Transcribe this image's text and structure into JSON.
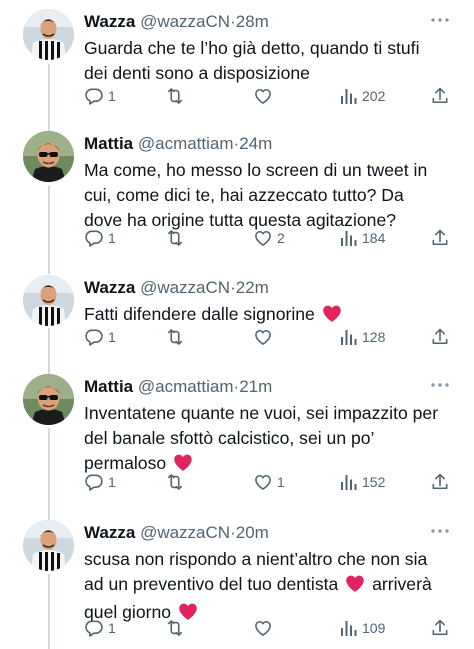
{
  "colors": {
    "muted": "#536471",
    "heart_emoji": "#e0245e",
    "thread_line": "#cfd9de"
  },
  "icons": {
    "reply": "speech-bubble",
    "retweet": "retweet-arrows",
    "like": "heart-outline",
    "views": "bar-chart",
    "share": "share-arrow-up",
    "more": "three-dots",
    "emoji": "red-heart"
  },
  "tweets": [
    {
      "name": "Wazza",
      "handle": "@wazzaCN",
      "dot": "·",
      "time": "28m",
      "lines": [
        "Guarda che te l’ho già detto, quando ti stufi",
        "dei denti sono a disposizione"
      ],
      "replies": "1",
      "retweets": "",
      "likes": "",
      "views": "202"
    },
    {
      "name": "Mattia",
      "handle": "@acmattiam",
      "dot": "·",
      "time": "24m",
      "lines": [
        "Ma come, ho messo lo screen di un tweet in",
        "cui, come dici te, hai azzeccato tutto? Da",
        "dove ha origine tutta questa agitazione?"
      ],
      "replies": "1",
      "retweets": "",
      "likes": "2",
      "views": "184"
    },
    {
      "name": "Wazza",
      "handle": "@wazzaCN",
      "dot": "·",
      "time": "22m",
      "text": "Fatti difendere dalle signorine",
      "replies": "1",
      "retweets": "",
      "likes": "",
      "views": "128"
    },
    {
      "name": "Mattia",
      "handle": "@acmattiam",
      "dot": "·",
      "time": "21m",
      "lines": [
        "Inventatene quante ne vuoi, sei impazzito per",
        "del banale sfottò calcistico, sei un po’",
        "permaloso"
      ],
      "replies": "1",
      "retweets": "",
      "likes": "1",
      "views": "152"
    },
    {
      "name": "Wazza",
      "handle": "@wazzaCN",
      "dot": "·",
      "time": "20m",
      "lines": [
        "scusa non rispondo a nient’altro che non sia",
        "ad un preventivo del tuo dentista",
        "arriverà",
        "quel giorno"
      ],
      "replies": "1",
      "retweets": "",
      "likes": "",
      "views": "109"
    }
  ]
}
